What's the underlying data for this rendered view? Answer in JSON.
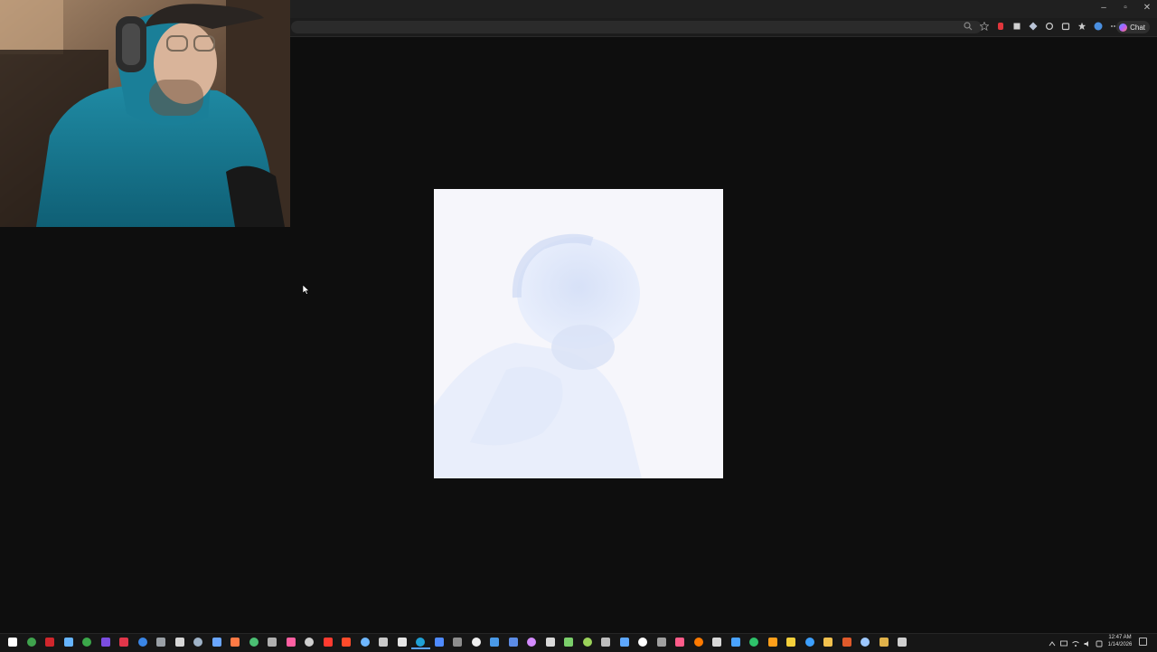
{
  "browser": {
    "window_controls": [
      "–",
      "▫",
      "✕"
    ],
    "chat_label": "Chat"
  },
  "webcam": {
    "description_icon": "streamer-webcam"
  },
  "content": {
    "image_icon": "washed-out-portrait-image"
  },
  "taskbar": {
    "apps": [
      {
        "name": "start",
        "color": "#ffffff"
      },
      {
        "name": "chrome",
        "color": "#3fa34d"
      },
      {
        "name": "opera",
        "color": "#d0262c"
      },
      {
        "name": "steam",
        "color": "#66b5ff"
      },
      {
        "name": "xbox",
        "color": "#3ba84a"
      },
      {
        "name": "app-purple",
        "color": "#7b4de0"
      },
      {
        "name": "app-red",
        "color": "#e0364a"
      },
      {
        "name": "app-blue",
        "color": "#3a86e6"
      },
      {
        "name": "app-x",
        "color": "#9aa0a6"
      },
      {
        "name": "app-z",
        "color": "#d6d6d6"
      },
      {
        "name": "app-shield",
        "color": "#9fb3c8"
      },
      {
        "name": "app-doc",
        "color": "#6aa6ff"
      },
      {
        "name": "app-orange",
        "color": "#ff7a45"
      },
      {
        "name": "app-green",
        "color": "#4bbf73"
      },
      {
        "name": "app-grey",
        "color": "#b0b0b0"
      },
      {
        "name": "app-pink",
        "color": "#ff5fa2"
      },
      {
        "name": "app-dark",
        "color": "#cfcfcf"
      },
      {
        "name": "app-red2",
        "color": "#ff3b30"
      },
      {
        "name": "app-flash",
        "color": "#ff4b2b"
      },
      {
        "name": "app-c",
        "color": "#6fb7ff"
      },
      {
        "name": "app-gear",
        "color": "#c9c9c9"
      },
      {
        "name": "app-epic",
        "color": "#e6e6e6"
      },
      {
        "name": "edge",
        "color": "#1fa1d6"
      },
      {
        "name": "app-blue2",
        "color": "#4f8bff"
      },
      {
        "name": "app-grey2",
        "color": "#8e8e8e"
      },
      {
        "name": "app-r",
        "color": "#f0f0f0"
      },
      {
        "name": "app-code",
        "color": "#4a9ae8"
      },
      {
        "name": "app-pic",
        "color": "#5c8ce6"
      },
      {
        "name": "app-img",
        "color": "#d48bff"
      },
      {
        "name": "app-nk",
        "color": "#d9d9d9"
      },
      {
        "name": "app-leaf",
        "color": "#7bcf6b"
      },
      {
        "name": "app-snake",
        "color": "#9bd35a"
      },
      {
        "name": "app-photo",
        "color": "#bdbdbd"
      },
      {
        "name": "app-wave",
        "color": "#5ea8ff"
      },
      {
        "name": "app-g",
        "color": "#ffffff"
      },
      {
        "name": "app-tools",
        "color": "#a0a0a0"
      },
      {
        "name": "app-grid",
        "color": "#ff5c8a"
      },
      {
        "name": "app-brave",
        "color": "#ff7a00"
      },
      {
        "name": "app-down",
        "color": "#d8d8d8"
      },
      {
        "name": "app-ps",
        "color": "#4aa3ff"
      },
      {
        "name": "app-green2",
        "color": "#2ec26a"
      },
      {
        "name": "app-orange2",
        "color": "#ff9f1a"
      },
      {
        "name": "app-y",
        "color": "#f5d03b"
      },
      {
        "name": "app-blue3",
        "color": "#3da0ff"
      },
      {
        "name": "app-folder",
        "color": "#f2c14e"
      },
      {
        "name": "app-m",
        "color": "#e05a2b"
      },
      {
        "name": "app-search",
        "color": "#9ec8ff"
      },
      {
        "name": "app-shield2",
        "color": "#e0b24a"
      },
      {
        "name": "app-file",
        "color": "#cfcfcf"
      }
    ],
    "clock_time": "12:47 AM",
    "clock_date": "1/14/2026"
  }
}
